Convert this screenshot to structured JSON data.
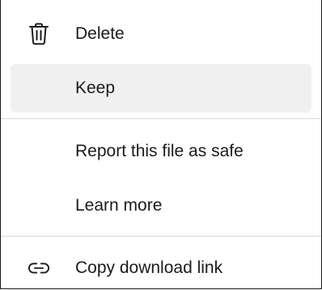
{
  "menu": {
    "items": [
      {
        "label": "Delete",
        "icon": "trash-icon"
      },
      {
        "label": "Keep",
        "icon": ""
      },
      {
        "label": "Report this file as safe",
        "icon": ""
      },
      {
        "label": "Learn more",
        "icon": ""
      },
      {
        "label": "Copy download link",
        "icon": "link-icon"
      }
    ]
  },
  "colors": {
    "highlight": "#f0f0f0",
    "divider": "#d9d9d9",
    "text": "#1b1b1b"
  }
}
